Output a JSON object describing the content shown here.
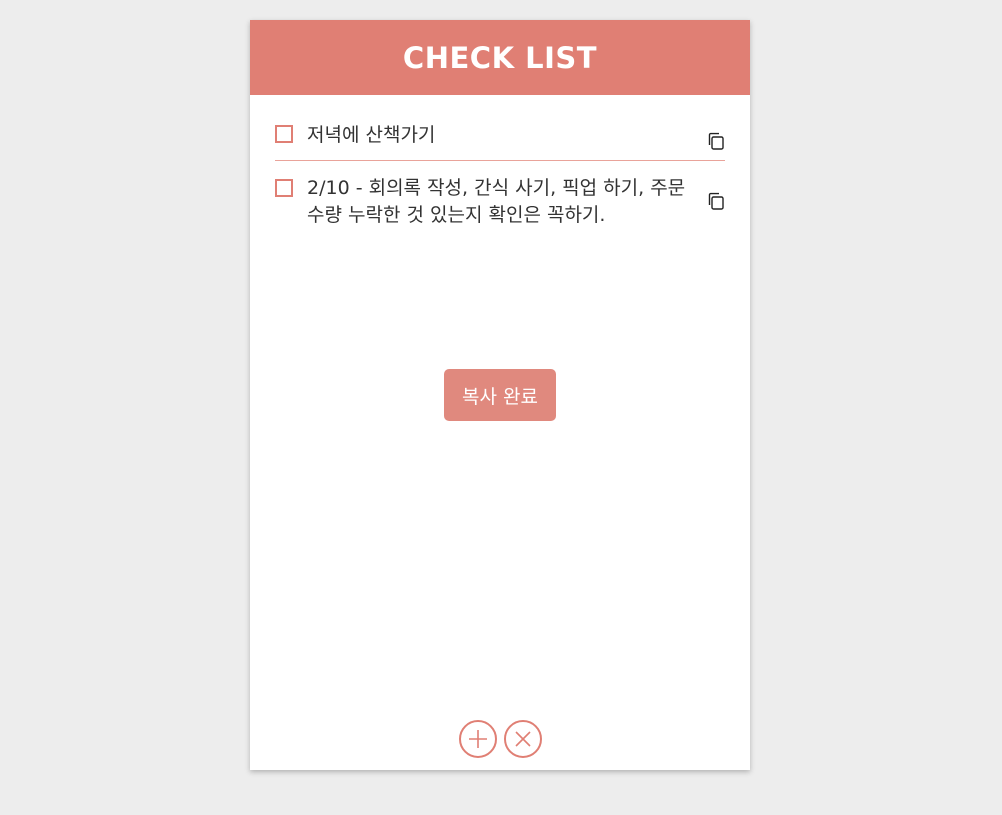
{
  "app": {
    "title": "CHECK LIST"
  },
  "items": [
    {
      "text": "저녁에 산책가기",
      "checked": false
    },
    {
      "text": "2/10 - 회의록 작성, 간식 사기, 픽업 하기, 주문 수량 누락한 것 있는지 확인은 꼭하기.",
      "checked": false
    }
  ],
  "toast": {
    "message": "복사 완료"
  },
  "footer": {
    "add_icon": "plus-icon",
    "delete_icon": "close-icon"
  },
  "colors": {
    "accent": "#e07f74",
    "toast_bg": "#e0897e",
    "background": "#ededed",
    "card": "#ffffff"
  }
}
